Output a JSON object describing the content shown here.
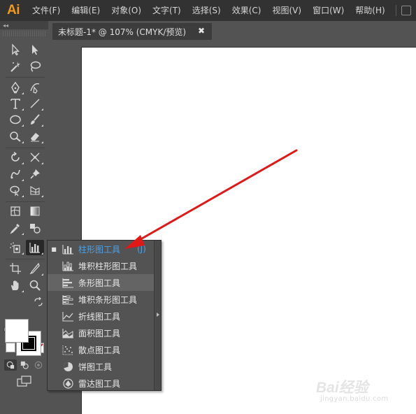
{
  "app": {
    "logo": "Ai"
  },
  "menu": [
    "文件(F)",
    "编辑(E)",
    "对象(O)",
    "文字(T)",
    "选择(S)",
    "效果(C)",
    "视图(V)",
    "窗口(W)",
    "帮助(H)"
  ],
  "toolbar": {
    "collapse": "◂◂"
  },
  "document_tab": {
    "title": "未标题-1* @ 107% (CMYK/预览)",
    "close": "✖"
  },
  "graph_flyout": {
    "items": [
      {
        "label": "柱形图工具",
        "shortcut": "(J)",
        "icon": "column-graph-icon",
        "selected": true,
        "highlighted": false
      },
      {
        "label": "堆积柱形图工具",
        "shortcut": "",
        "icon": "stacked-column-graph-icon",
        "selected": false,
        "highlighted": false
      },
      {
        "label": "条形图工具",
        "shortcut": "",
        "icon": "bar-graph-icon",
        "selected": false,
        "highlighted": true
      },
      {
        "label": "堆积条形图工具",
        "shortcut": "",
        "icon": "stacked-bar-graph-icon",
        "selected": false,
        "highlighted": false
      },
      {
        "label": "折线图工具",
        "shortcut": "",
        "icon": "line-graph-icon",
        "selected": false,
        "highlighted": false
      },
      {
        "label": "面积图工具",
        "shortcut": "",
        "icon": "area-graph-icon",
        "selected": false,
        "highlighted": false
      },
      {
        "label": "散点图工具",
        "shortcut": "",
        "icon": "scatter-graph-icon",
        "selected": false,
        "highlighted": false
      },
      {
        "label": "饼图工具",
        "shortcut": "",
        "icon": "pie-graph-icon",
        "selected": false,
        "highlighted": false
      },
      {
        "label": "雷达图工具",
        "shortcut": "",
        "icon": "radar-graph-icon",
        "selected": false,
        "highlighted": false
      }
    ]
  },
  "colors": {
    "annotation_arrow": "#e01818",
    "selected_text": "#4aa1e6",
    "logo": "#f29a1c"
  },
  "watermark": {
    "main": "Bai经验",
    "sub": "jingyan.baidu.com"
  }
}
